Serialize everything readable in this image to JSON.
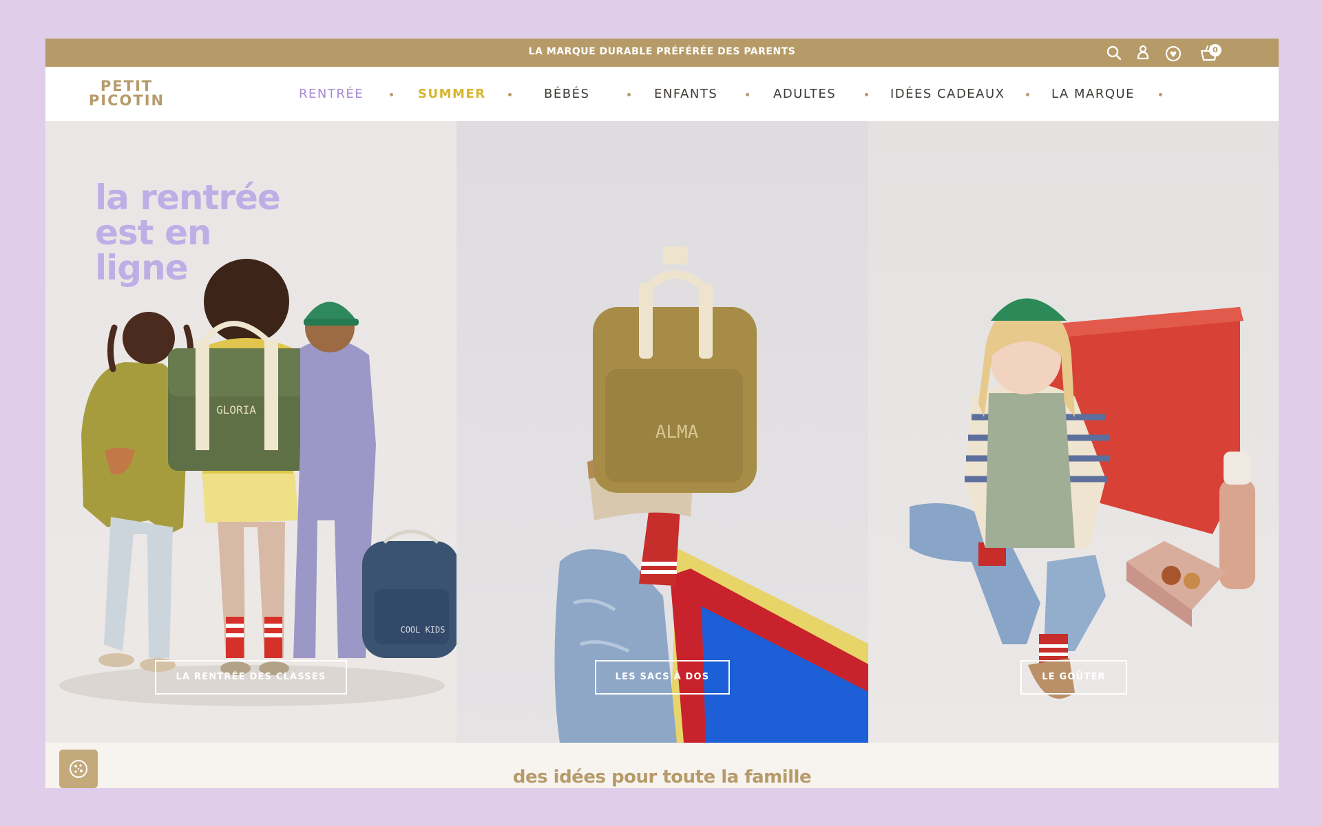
{
  "announcement": {
    "text": "LA MARQUE DURABLE PRÉFÉRÉE DES PARENTS"
  },
  "utility": {
    "search_icon": "search-icon",
    "account_icon": "user-icon",
    "loyalty_icon": "heart-coin-icon",
    "cart_icon": "basket-icon",
    "cart_count": "0"
  },
  "logo": {
    "line1": "PETIT",
    "line2": "PICOTIN"
  },
  "nav": {
    "items": [
      {
        "label": "RENTRÉE"
      },
      {
        "label": "SUMMER"
      },
      {
        "label": "BÉBÉS"
      },
      {
        "label": "ENFANTS"
      },
      {
        "label": "ADULTES"
      },
      {
        "label": "IDÉES CADEAUX"
      },
      {
        "label": "LA MARQUE"
      }
    ]
  },
  "hero": {
    "title_line1": "la rentrée",
    "title_line2": "est en",
    "title_line3": "ligne",
    "panels": [
      {
        "cta": "LA RENTRÉE DES CLASSES"
      },
      {
        "cta": "LES SACS À DOS"
      },
      {
        "cta": "LE GOÛTER"
      }
    ],
    "bag_names": {
      "satchel": "GLORIA",
      "backpack": "ALMA",
      "small_backpack": "COOL KIDS"
    }
  },
  "section": {
    "title": "des idées pour toute la famille"
  },
  "cookie": {
    "icon": "cookie-icon"
  },
  "colors": {
    "brand_gold": "#b69b69",
    "lavender": "#bfaee6",
    "background": "#dfcdea",
    "summer_yellow": "#d7b52c"
  }
}
